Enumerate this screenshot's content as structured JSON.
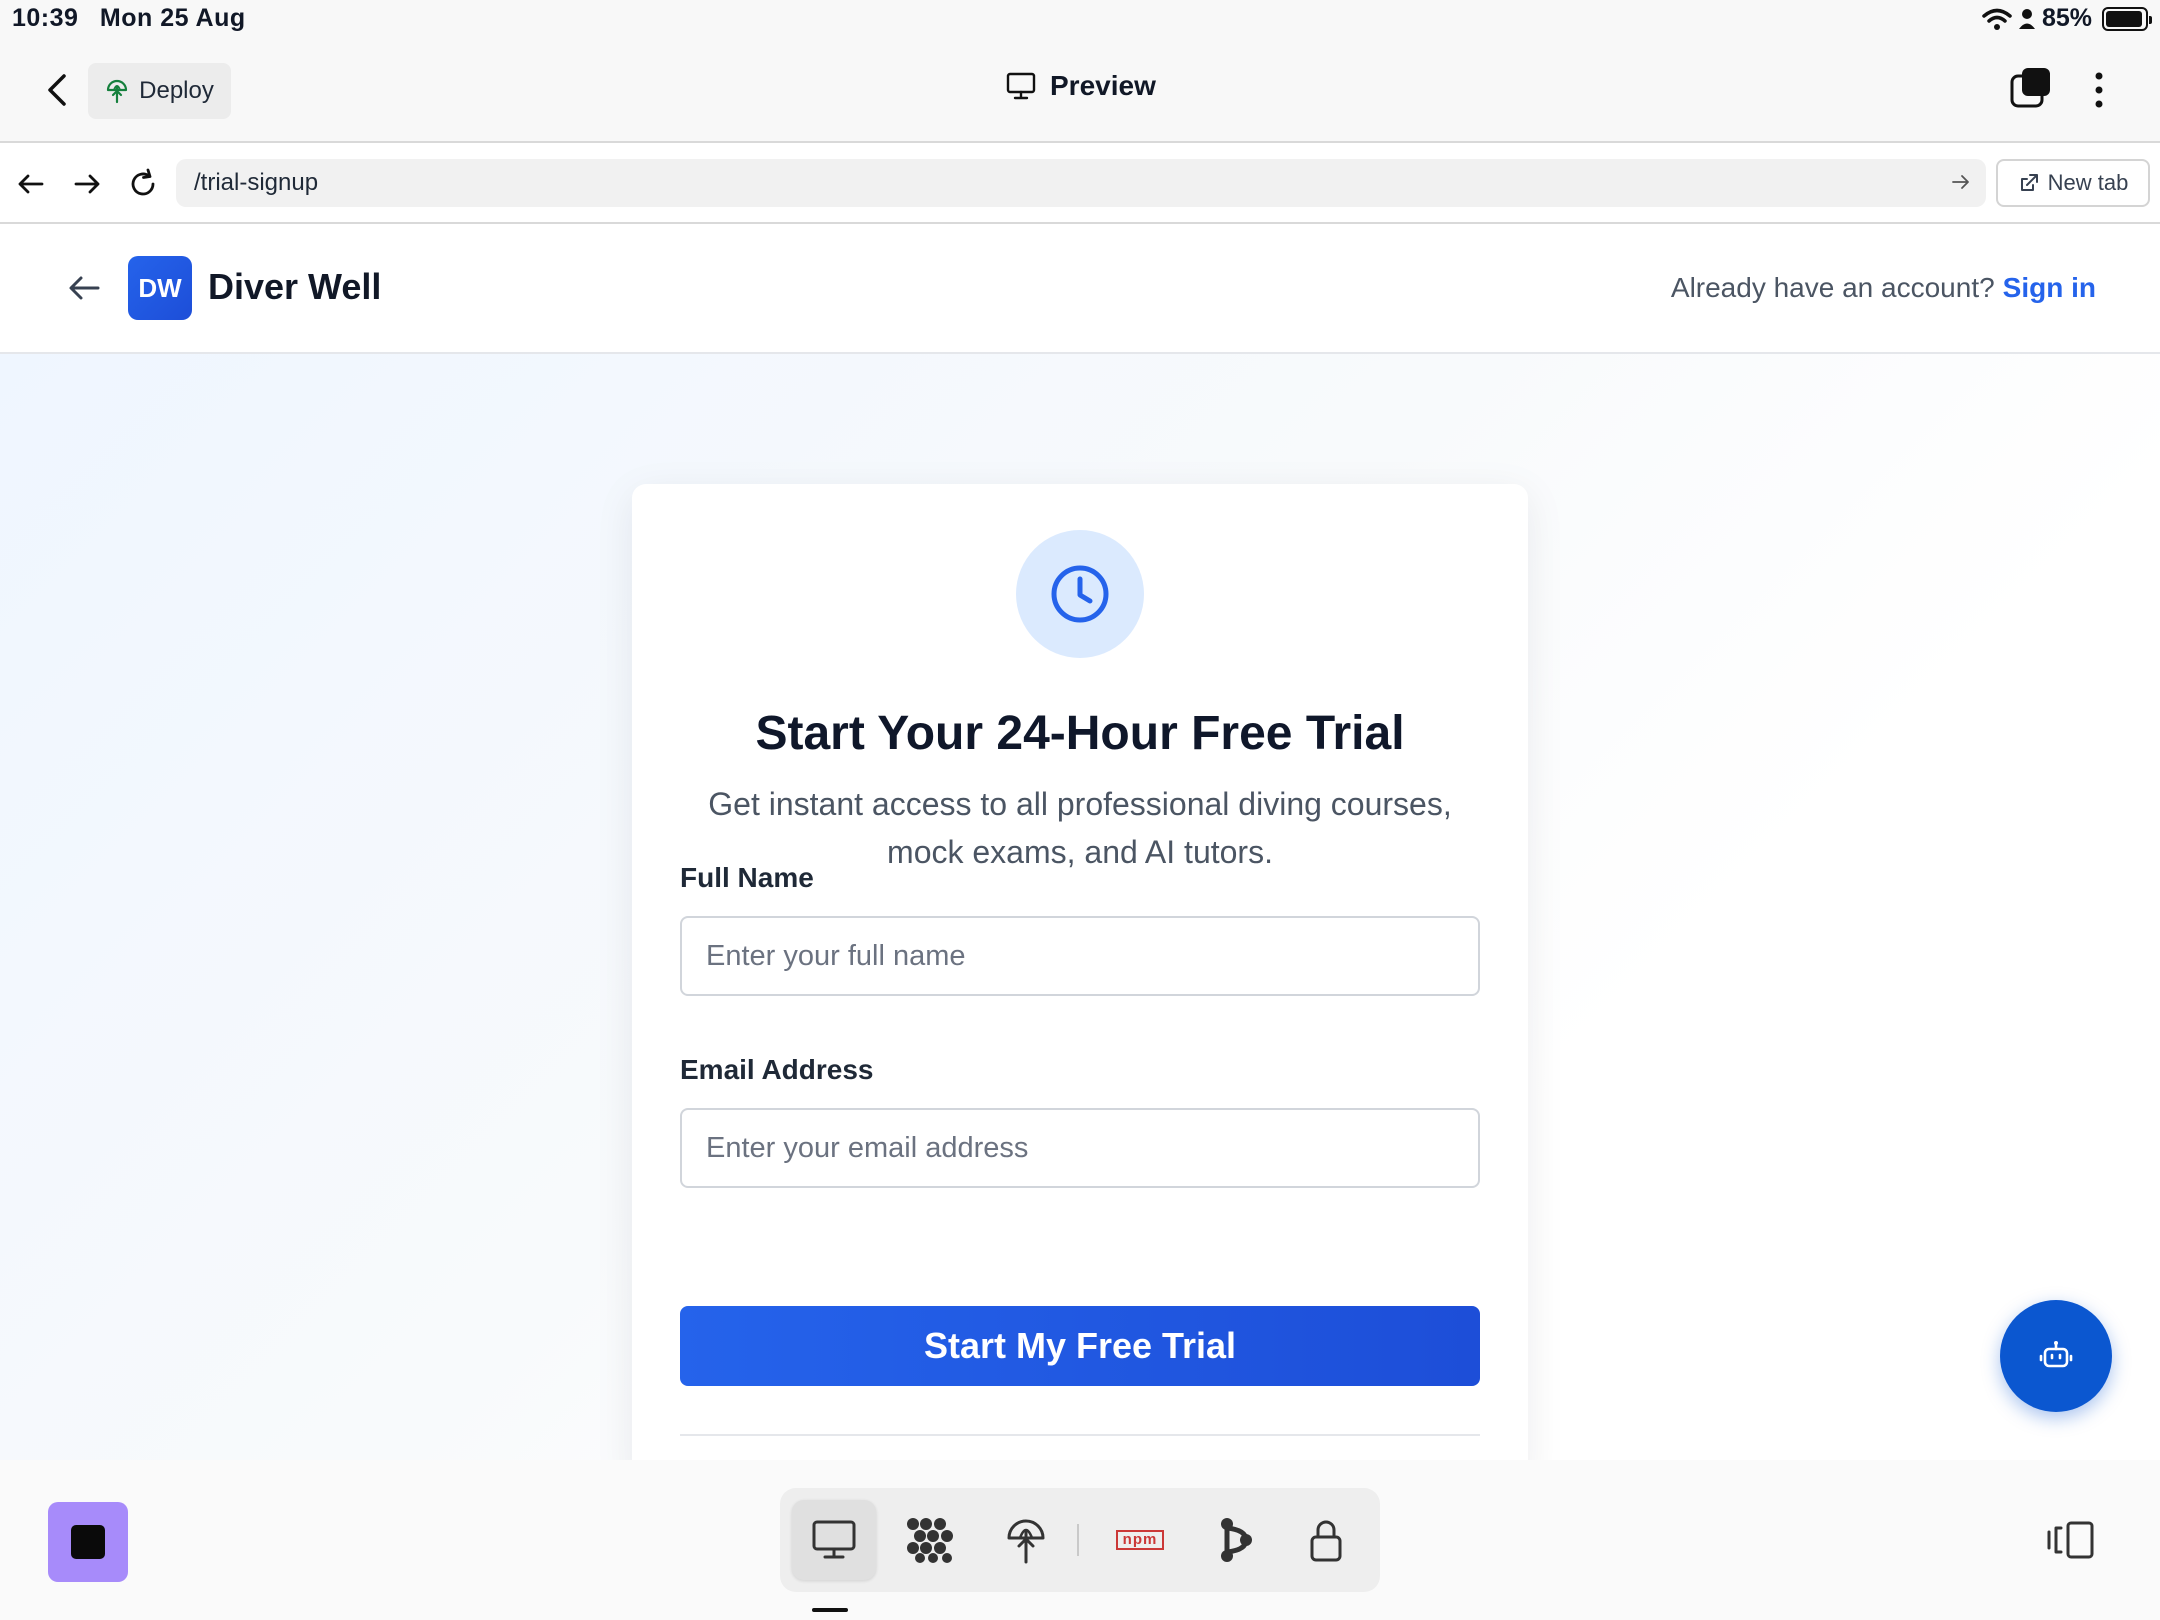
{
  "status_bar": {
    "time": "10:39",
    "date": "Mon 25 Aug",
    "battery": "85%"
  },
  "app_bar": {
    "deploy_label": "Deploy",
    "title": "Preview"
  },
  "browser": {
    "url": "/trial-signup",
    "new_tab_label": "New tab"
  },
  "site": {
    "logo_initials": "DW",
    "brand_name": "Diver Well",
    "signin_prompt": "Already have an account?",
    "signin_link": "Sign in"
  },
  "signup": {
    "title": "Start Your 24-Hour Free Trial",
    "subtitle": "Get instant access to all professional diving courses, mock exams, and AI tutors.",
    "full_name_label": "Full Name",
    "full_name_placeholder": "Enter your full name",
    "email_label": "Email Address",
    "email_placeholder": "Enter your email address",
    "submit_label": "Start My Free Trial"
  },
  "dock": {
    "npm_label": "npm",
    "items": [
      "preview-icon",
      "packages-icon",
      "deploy-icon",
      "npm-icon",
      "git-icon",
      "secrets-icon"
    ]
  },
  "colors": {
    "accent": "#2563eb",
    "fab": "#0b57d0",
    "stop_button": "#a78bfa",
    "deploy_icon": "#15803d"
  }
}
